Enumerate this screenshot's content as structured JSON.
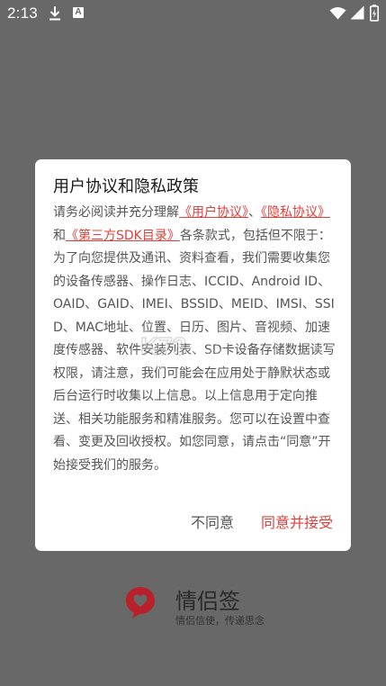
{
  "status_bar": {
    "time": "2:13",
    "icons": [
      "download-icon",
      "a-notification-icon",
      "wifi-icon",
      "signal-icon",
      "battery-icon"
    ],
    "notification_letter": "A"
  },
  "dialog": {
    "title": "用户协议和隐私政策",
    "body": {
      "intro": "请务必阅读并充分理解",
      "link_user_agreement": "《用户协议》",
      "separator": "、",
      "link_privacy_policy": "《隐私协议》",
      "and": "和",
      "link_sdk_list": "《第三方SDK目录》",
      "main_text": "各条款式，包括但不限于：为了向您提供及通讯、资料查看，我们需要收集您的设备传感器、操作日志、ICCID、Android ID、OAID、GAID、IMEI、BSSID、MEID、IMSI、SSID、MAC地址、位置、日历、图片、音视频、加速度传感器、软件安装列表、SD卡设备存储数据读写权限，请注意，我们可能会在应用处于静默状态或后台运行时收集以上信息。以上信息用于定向推送、相关功能服务和精准服务。您可以在设置中查看、变更及回收授权。如您同意，请点击“同意”开始接受我们的服务。"
    },
    "disagree_label": "不同意",
    "agree_label": "同意并接受"
  },
  "watermark": {
    "text": "游戏之家",
    "url": "k73.com"
  },
  "brand": {
    "name": "情侣签",
    "slogan": "情侣信使，传递思念"
  },
  "colors": {
    "backdrop": "#686868",
    "accent": "#e0403a",
    "dialog_bg": "#ffffff",
    "logo_red": "#b8202a"
  }
}
